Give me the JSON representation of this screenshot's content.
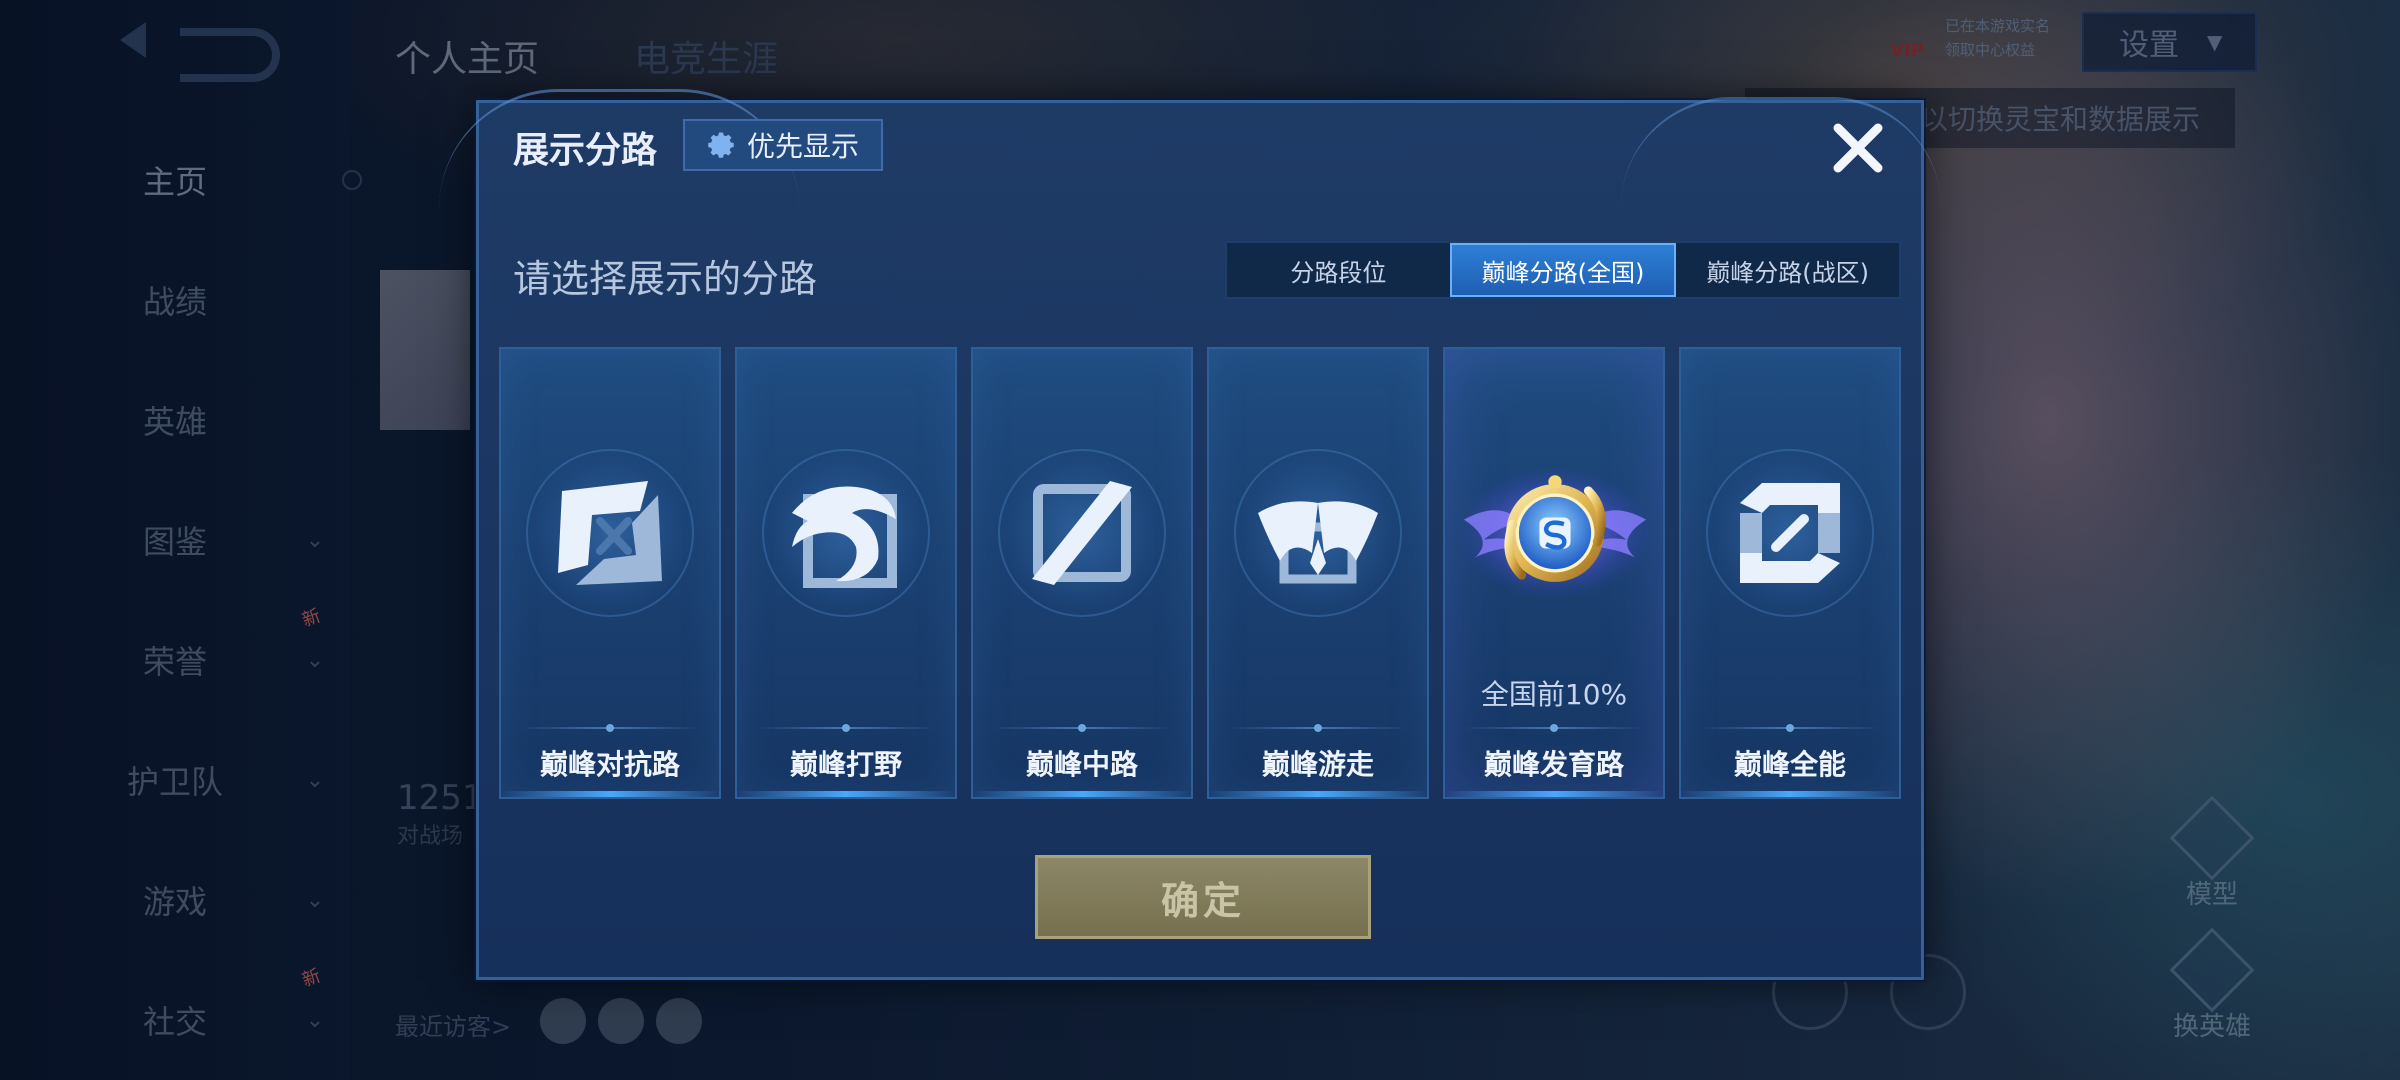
{
  "background": {
    "nav_items": [
      {
        "label": "主页",
        "active": true,
        "chevron": false,
        "new": false
      },
      {
        "label": "战绩",
        "active": false,
        "chevron": false,
        "new": false
      },
      {
        "label": "英雄",
        "active": false,
        "chevron": false,
        "new": false
      },
      {
        "label": "图鉴",
        "active": false,
        "chevron": true,
        "new": false
      },
      {
        "label": "荣誉",
        "active": false,
        "chevron": true,
        "new": true
      },
      {
        "label": "护卫队",
        "active": false,
        "chevron": true,
        "new": false
      },
      {
        "label": "游戏",
        "active": false,
        "chevron": true,
        "new": false
      },
      {
        "label": "社交",
        "active": false,
        "chevron": true,
        "new": true
      }
    ],
    "new_badge": "新",
    "top_tabs": [
      "个人主页",
      "电竞生涯"
    ],
    "settings_label": "设置",
    "vip_label": "VIP",
    "vip_info_line1": "已在本游戏实名",
    "vip_info_line2": "领取中心权益",
    "hint_text": "以切换灵宝和数据展示",
    "count_text": "1251",
    "count_sub": "对战场",
    "recent_visitors": "最近访客>",
    "model_label": "模型",
    "switch_hero_label": "换英雄"
  },
  "modal": {
    "title": "展示分路",
    "priority_label": "优先显示",
    "prompt": "请选择展示的分路",
    "segments": [
      {
        "label": "分路段位",
        "active": false
      },
      {
        "label": "巅峰分路(全国)",
        "active": true
      },
      {
        "label": "巅峰分路(战区)",
        "active": false
      }
    ],
    "cards": [
      {
        "label": "巅峰对抗路",
        "icon": "crossed-swords-icon",
        "rank": ""
      },
      {
        "label": "巅峰打野",
        "icon": "dragon-icon",
        "rank": ""
      },
      {
        "label": "巅峰中路",
        "icon": "blade-icon",
        "rank": ""
      },
      {
        "label": "巅峰游走",
        "icon": "wings-icon",
        "rank": ""
      },
      {
        "label": "巅峰发育路",
        "icon": "gold-emblem-icon",
        "rank": "全国前10%"
      },
      {
        "label": "巅峰全能",
        "icon": "allround-icon",
        "rank": ""
      }
    ],
    "confirm_label": "确定"
  },
  "colors": {
    "modal_bg": "#1e3b66",
    "segment_active": "#2e7fd6",
    "confirm_bg": "#8c8766",
    "emblem_gold": "#e0b553",
    "emblem_blue": "#2d8bf0"
  }
}
